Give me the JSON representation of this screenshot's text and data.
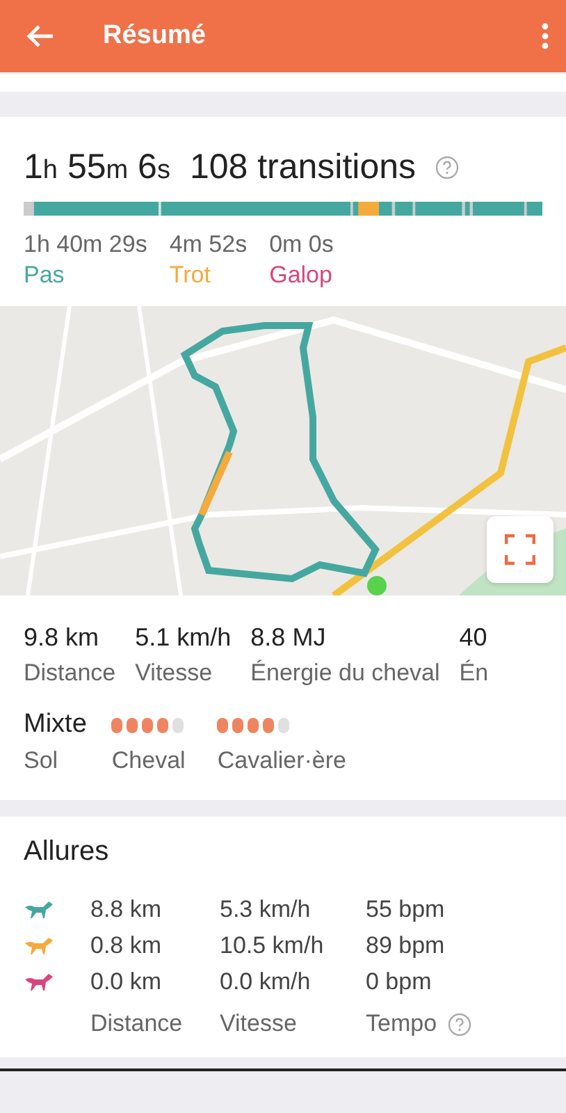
{
  "app_bar": {
    "title": "Résumé"
  },
  "summary": {
    "duration": [
      {
        "num": "1",
        "unit": "h"
      },
      {
        "num": "55",
        "unit": "m"
      },
      {
        "num": "6",
        "unit": "s"
      }
    ],
    "transitions": "108 transitions",
    "gaits": [
      {
        "time": "1h 40m 29s",
        "label": "Pas",
        "color": "#45a8a0"
      },
      {
        "time": "4m 52s",
        "label": "Trot",
        "color": "#f5aa3c"
      },
      {
        "time": "0m 0s",
        "label": "Galop",
        "color": "#d9457f"
      }
    ]
  },
  "stats": [
    {
      "value": "9.8 km",
      "label": "Distance"
    },
    {
      "value": "5.1 km/h",
      "label": "Vitesse"
    },
    {
      "value": "8.8 MJ",
      "label": "Énergie du cheval"
    },
    {
      "value": "40",
      "label": "Én"
    }
  ],
  "ratings": [
    {
      "kind": "text",
      "value": "Mixte",
      "label": "Sol"
    },
    {
      "kind": "dots",
      "stars": 4,
      "label": "Cheval"
    },
    {
      "kind": "dots",
      "stars": 4,
      "label": "Cavalier·ère"
    }
  ],
  "allures": {
    "title": "Allures",
    "rows": [
      {
        "color": "#45a8a0",
        "distance": "8.8 km",
        "speed": "5.3 km/h",
        "tempo": "55 bpm"
      },
      {
        "color": "#f5aa3c",
        "distance": "0.8 km",
        "speed": "10.5 km/h",
        "tempo": "89 bpm"
      },
      {
        "color": "#d9457f",
        "distance": "0.0 km",
        "speed": "0.0 km/h",
        "tempo": "0 bpm"
      }
    ],
    "columns": [
      "Distance",
      "Vitesse",
      "Tempo"
    ]
  }
}
